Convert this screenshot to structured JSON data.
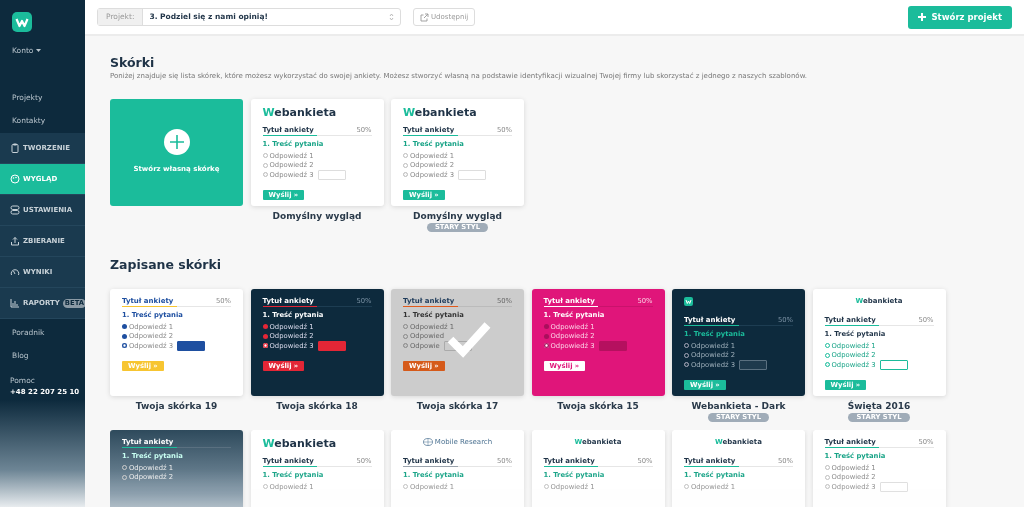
{
  "sidebar": {
    "account": "Konto",
    "links": [
      {
        "label": "Projekty"
      },
      {
        "label": "Kontakty"
      }
    ],
    "sections": [
      {
        "label": "TWORZENIE",
        "selected": false
      },
      {
        "label": "WYGLĄD",
        "selected": true
      },
      {
        "label": "USTAWIENIA",
        "selected": false
      },
      {
        "label": "ZBIERANIE",
        "selected": false
      },
      {
        "label": "WYNIKI",
        "selected": false
      },
      {
        "label": "RAPORTY",
        "selected": false,
        "badge": "BETA"
      }
    ],
    "footer_links": [
      {
        "label": "Poradnik"
      },
      {
        "label": "Blog"
      }
    ],
    "help": {
      "label": "Pomoc",
      "phone": "+48 22 207 25 10"
    }
  },
  "toolbar": {
    "project_label": "Projekt:",
    "project": "3. Podziel się z nami opinią!",
    "share": {
      "label": "Udostępnij",
      "disabled": true
    },
    "create": "Stwórz projekt"
  },
  "skins": {
    "title": "Skórki",
    "description": "Poniżej znajduje się lista skórek, które możesz wykorzystać do swojej ankiety. Możesz stworzyć własną na podstawie identyfikacji wizualnej Twojej firmy lub skorzystać z jednego z naszych szablonów.",
    "create_card": "Stwórz własną skórkę",
    "items": [
      {
        "name": "Domyślny wygląd",
        "kind": "default",
        "selected": false,
        "logo": {
          "kind": "wordmark",
          "text": "Webankieta"
        },
        "preview": {
          "title": "Tytuł ankiety",
          "percent": "50%",
          "level": 0.5,
          "question": "1. Treść pytania",
          "answers": [
            "Odpowiedź 1",
            "Odpowiedź 2",
            "Odpowiedź 3"
          ],
          "submit": "Wyślij »"
        }
      },
      {
        "name": "Domyślny wygląd",
        "kind": "default",
        "selected": false,
        "badge": "STARY STYL",
        "logo": {
          "kind": "wordmark",
          "text": "Webankieta"
        },
        "preview": {
          "title": "Tytuł ankiety",
          "percent": "50%",
          "level": 0.5,
          "question": "1. Treść pytania",
          "answers": [
            "Odpowiedź 1",
            "Odpowiedź 2",
            "Odpowiedź 3"
          ],
          "submit": "Wyślij »"
        }
      }
    ]
  },
  "saved": {
    "title": "Zapisane skórki",
    "items": [
      {
        "name": "Twoja skórka 19",
        "kind": "yellow",
        "selected": false,
        "preview": {
          "title": "Tytuł ankiety",
          "percent": "50%",
          "level": 0.5,
          "question": "1. Treść pytania",
          "answers": [
            "Odpowiedź 1",
            "Odpowiedź 2",
            "Odpowiedź 3"
          ],
          "submit": "Wyślij »"
        }
      },
      {
        "name": "Twoja skórka 18",
        "kind": "navyred",
        "selected": false,
        "preview": {
          "title": "Tytuł ankiety",
          "percent": "50%",
          "level": 0.5,
          "question": "1. Treść pytania",
          "answers": [
            "Odpowiedź 1",
            "Odpowiedź 2",
            "Odpowiedź 3"
          ],
          "submit": "Wyślij »"
        }
      },
      {
        "name": "Twoja skórka 17",
        "kind": "grey",
        "selected": true,
        "preview": {
          "title": "Tytuł ankiety",
          "percent": "50%",
          "level": 0.5,
          "question": "1. Treść pytania",
          "answers": [
            "Odpowiedź 1",
            "Odpowied",
            "Odpowie"
          ],
          "submit": "Wyślij »"
        }
      },
      {
        "name": "Twoja skórka 15",
        "kind": "pink",
        "selected": false,
        "preview": {
          "title": "Tytuł ankiety",
          "percent": "50%",
          "level": 0.5,
          "question": "1. Treść pytania",
          "answers": [
            "Odpowiedź 1",
            "Odpowiedź 2",
            "Odpowiedź 3"
          ],
          "submit": "Wyślij »"
        }
      },
      {
        "name": "Webankieta - Dark",
        "kind": "dark",
        "selected": false,
        "badge": "STARY STYL",
        "logo": {
          "kind": "mark"
        },
        "preview": {
          "title": "Tytuł ankiety",
          "percent": "50%",
          "level": 0.5,
          "question": "1. Treść pytania",
          "answers": [
            "Odpowiedź 1",
            "Odpowiedź 2",
            "Odpowiedź 3"
          ],
          "submit": "Wyślij »"
        }
      },
      {
        "name": "Święta 2016",
        "kind": "holiday",
        "selected": false,
        "badge": "STARY STYL",
        "logo": {
          "kind": "small",
          "text": "Webankieta"
        },
        "preview": {
          "title": "Tytuł ankiety",
          "percent": "50%",
          "level": 0.5,
          "question": "1. Treść pytania",
          "answers": [
            "Odpowiedź 1",
            "Odpowiedź 2",
            "Odpowiedź 3"
          ],
          "submit": "Wyślij »"
        }
      }
    ]
  },
  "more_skins": [
    {
      "kind": "fade",
      "preview": {
        "title": "Tytuł ankiety",
        "level": 0.5,
        "question": "1. Treść pytania",
        "answers": [
          "Odpowiedź 1",
          "Odpowiedź 2"
        ]
      }
    },
    {
      "kind": "default",
      "logo": {
        "kind": "wordmark",
        "text": "Webankieta"
      },
      "preview": {
        "title": "Tytuł ankiety",
        "percent": "50%",
        "level": 0.5,
        "question": "1. Treść pytania",
        "answers": [
          "Odpowiedź 1"
        ]
      }
    },
    {
      "kind": "greybar",
      "logo": {
        "kind": "research",
        "text": "Mobile Research"
      },
      "preview": {
        "title": "Tytuł ankiety",
        "percent": "50%",
        "level": 0.5,
        "question": "1. Treść pytania",
        "answers": [
          "Odpowiedź 1"
        ]
      }
    },
    {
      "kind": "default",
      "logo": {
        "kind": "small",
        "text": "Webankieta"
      },
      "preview": {
        "title": "Tytuł ankiety",
        "percent": "50%",
        "level": 0.5,
        "question": "1. Treść pytania",
        "answers": [
          "Odpowiedź 1"
        ]
      }
    },
    {
      "kind": "default",
      "logo": {
        "kind": "small",
        "text": "Webankieta"
      },
      "preview": {
        "title": "Tytuł ankiety",
        "percent": "50%",
        "level": 0.5,
        "question": "1. Treść pytania",
        "answers": [
          "Odpowiedź 1"
        ]
      }
    },
    {
      "kind": "default",
      "preview": {
        "title": "Tytuł ankiety",
        "percent": "50%",
        "level": 0.5,
        "question": "1. Treść pytania",
        "answers": [
          "Odpowiedź 1",
          "Odpowiedź 2",
          "Odpowiedź 3"
        ]
      }
    }
  ]
}
